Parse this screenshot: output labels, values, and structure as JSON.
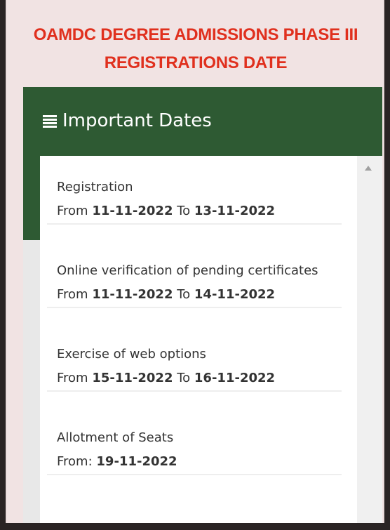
{
  "heading": {
    "line1": "OAMDC DEGREE ADMISSIONS PHASE III",
    "line2": "REGISTRATIONS DATE"
  },
  "panel": {
    "title": "Important Dates",
    "title_icon": "list-icon"
  },
  "items": [
    {
      "title": "Registration",
      "from_label": "From",
      "from": "11-11-2022",
      "to_label": "To",
      "to": "13-11-2022"
    },
    {
      "title": "Online verification of pending certificates",
      "from_label": "From",
      "from": "11-11-2022",
      "to_label": "To",
      "to": "14-11-2022"
    },
    {
      "title": "Exercise of web options",
      "from_label": "From",
      "from": "15-11-2022",
      "to_label": "To",
      "to": "16-11-2022"
    },
    {
      "title": "Allotment of Seats",
      "from_label": "From:",
      "from": "19-11-2022"
    }
  ],
  "colors": {
    "heading_red": "#e0301e",
    "header_green": "#2e5a33",
    "background_pink": "#f1e3e3"
  }
}
